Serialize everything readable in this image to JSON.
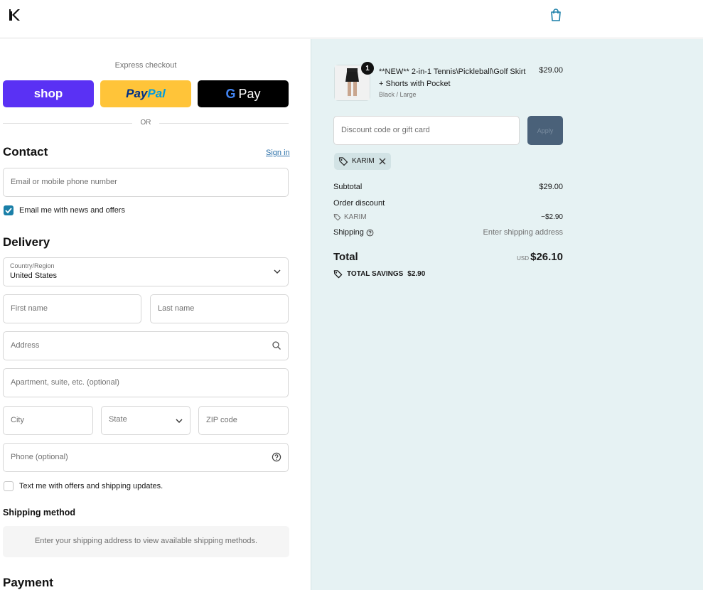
{
  "header": {
    "logo_icon": "brand-k-logo",
    "cart_icon": "shopping-bag-icon"
  },
  "express": {
    "title": "Express checkout",
    "shop_label": "shop",
    "paypal_label_a": "Pay",
    "paypal_label_b": "Pal",
    "gpay_label": "Pay",
    "gpay_g": "G",
    "or": "OR"
  },
  "contact": {
    "title": "Contact",
    "sign_in": "Sign in",
    "email_placeholder": "Email or mobile phone number",
    "news_label": "Email me with news and offers",
    "news_checked": true
  },
  "delivery": {
    "title": "Delivery",
    "country_label": "Country/Region",
    "country_value": "United States",
    "first_name": "First name",
    "last_name": "Last name",
    "address": "Address",
    "apartment": "Apartment, suite, etc. (optional)",
    "city": "City",
    "state": "State",
    "zip": "ZIP code",
    "phone": "Phone (optional)",
    "sms_label": "Text me with offers and shipping updates.",
    "sms_checked": false
  },
  "shipping_method": {
    "title": "Shipping method",
    "message": "Enter your shipping address to view available shipping methods."
  },
  "payment": {
    "title": "Payment"
  },
  "summary": {
    "product": {
      "name": "**NEW** 2-in-1 Tennis\\Pickleball\\Golf Skirt + Shorts with Pocket",
      "variant": "Black / Large",
      "price": "$29.00",
      "quantity": "1"
    },
    "discount_placeholder": "Discount code or gift card",
    "apply_label": "Apply",
    "applied_code": "KARIM",
    "subtotal_label": "Subtotal",
    "subtotal_value": "$29.00",
    "order_discount_label": "Order discount",
    "discount_code": "KARIM",
    "discount_value": "−$2.90",
    "shipping_label": "Shipping",
    "shipping_value": "Enter shipping address",
    "total_label": "Total",
    "currency": "USD",
    "total_value": "$26.10",
    "savings_label": "TOTAL SAVINGS",
    "savings_value": "$2.90"
  },
  "colors": {
    "shop": "#5a31f4",
    "paypal": "#ffc439",
    "gpay": "#000000",
    "accent": "#1a7fa8",
    "summary_bg": "#e6f2f3"
  }
}
